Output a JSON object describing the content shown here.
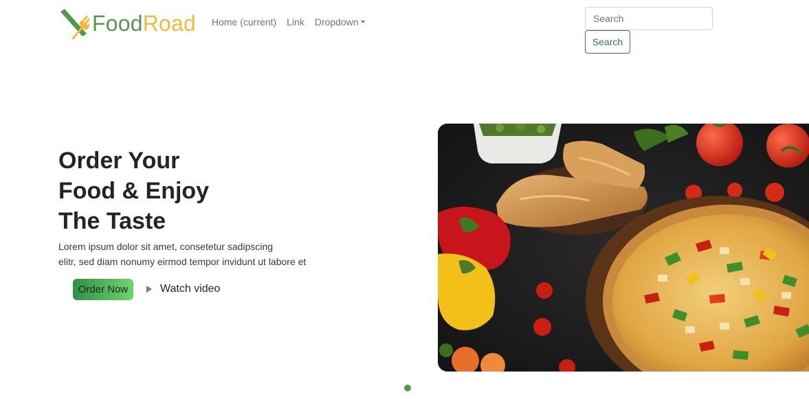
{
  "brand": {
    "name_part1": "Food",
    "name_part2": "Road",
    "logo_icon": "fork-knife-icon",
    "colors": {
      "green": "#4f9a4d",
      "yellow": "#f2b93b"
    }
  },
  "nav": {
    "items": [
      {
        "label": "Home (current)"
      },
      {
        "label": "Link"
      },
      {
        "label": "Dropdown"
      }
    ]
  },
  "search": {
    "placeholder": "Search",
    "button_label": "Search"
  },
  "hero": {
    "title_lines": [
      "Order Your",
      "Food & Enjoy",
      "The Taste"
    ],
    "text_lines": [
      "Lorem ipsum dolor sit amet, consetetur sadipscing",
      "elitr, sed diam nonumy eirmod tempor invidunt ut labore et"
    ],
    "order_button": "Order Now",
    "watch_label": "Watch video",
    "watch_icon": "play-icon",
    "image_subject": "pizza-photo",
    "accent_color": "#4f9a4d"
  }
}
